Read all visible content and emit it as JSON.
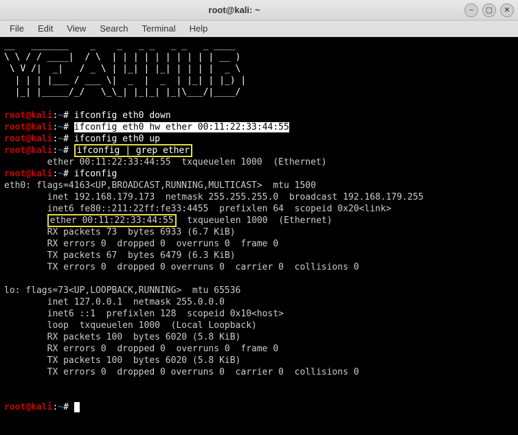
{
  "window": {
    "title": "root@kali: ~"
  },
  "menubar": {
    "file": "File",
    "edit": "Edit",
    "view": "View",
    "search": "Search",
    "terminal": "Terminal",
    "help": "Help"
  },
  "ascii_art": "__   _______    _    _   _ _   _ _   _ ____\n\\ \\ / / ____|  / \\  | | | | | | | | | | __ )\n \\ V /|  _|   / _ \\ | |_| | |_| | | | |  _ \\\n  | | | |___ / ___ \\|  _  |  _  | |_| | |_) |\n  |_| |_____/_/   \\_\\_| |_|_| |_|\\___/|____/",
  "prompt": {
    "user": "root",
    "host": "@kali",
    "colon": ":",
    "path": "~",
    "hash": "# "
  },
  "lines": {
    "cmd1": "ifconfig eth0 down",
    "cmd2_pre": "",
    "cmd2_hl": "ifconfig eth0 hw ether 00:11:22:33:44:55",
    "cmd3": "ifconfig eth0 up",
    "cmd4_box": "ifconfig | grep ether",
    "out_grep": "        ether 00:11:22:33:44:55  txqueuelen 1000  (Ethernet)",
    "cmd5": "ifconfig",
    "eth0_flags": "eth0: flags=4163<UP,BROADCAST,RUNNING,MULTICAST>  mtu 1500",
    "eth0_inet": "        inet 192.168.179.173  netmask 255.255.255.0  broadcast 192.168.179.255",
    "eth0_inet6": "        inet6 fe80::211:22ff:fe33:4455  prefixlen 64  scopeid 0x20<link>",
    "eth0_ether_pre": "        ",
    "eth0_ether_box": "ether 00:11:22:33:44:55",
    "eth0_ether_post": "  txqueuelen 1000  (Ethernet)",
    "eth0_rxp": "        RX packets 73  bytes 6933 (6.7 KiB)",
    "eth0_rxe": "        RX errors 0  dropped 0  overruns 0  frame 0",
    "eth0_txp": "        TX packets 67  bytes 6479 (6.3 KiB)",
    "eth0_txe": "        TX errors 0  dropped 0 overruns 0  carrier 0  collisions 0",
    "blank": "",
    "lo_flags": "lo: flags=73<UP,LOOPBACK,RUNNING>  mtu 65536",
    "lo_inet": "        inet 127.0.0.1  netmask 255.0.0.0",
    "lo_inet6": "        inet6 ::1  prefixlen 128  scopeid 0x10<host>",
    "lo_loop": "        loop  txqueuelen 1000  (Local Loopback)",
    "lo_rxp": "        RX packets 100  bytes 6020 (5.8 KiB)",
    "lo_rxe": "        RX errors 0  dropped 0  overruns 0  frame 0",
    "lo_txp": "        TX packets 100  bytes 6020 (5.8 KiB)",
    "lo_txe": "        TX errors 0  dropped 0 overruns 0  carrier 0  collisions 0",
    "cursor": " "
  }
}
